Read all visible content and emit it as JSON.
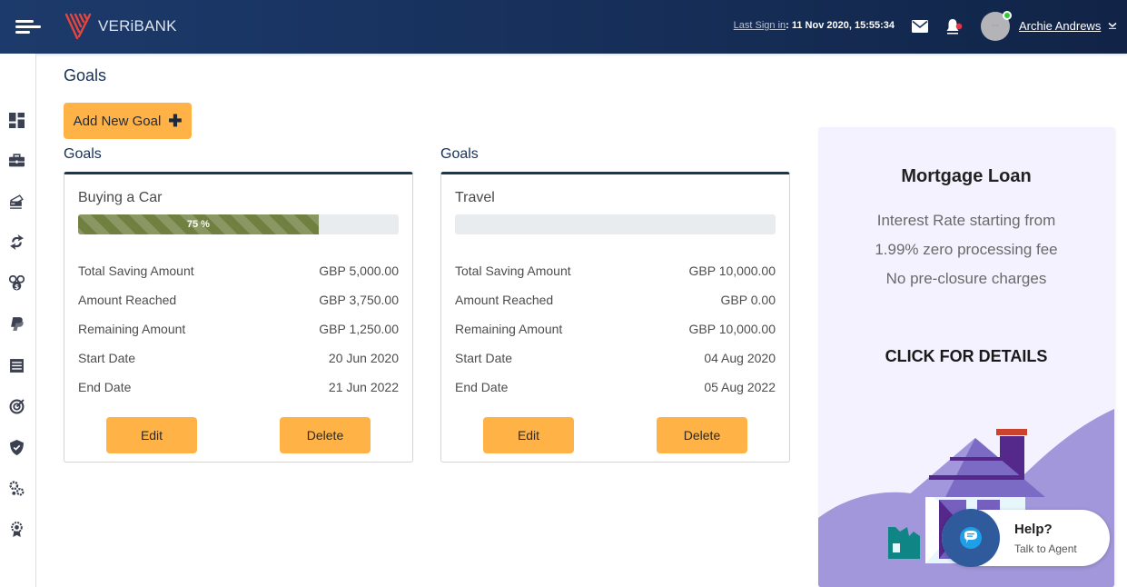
{
  "header": {
    "brand": "VERiBANK",
    "last_signin_label": "Last Sign in",
    "last_signin_value": ": 11 Nov 2020, 15:55:34",
    "user_name": "Archie Andrews",
    "notification_dot_color": "#e8334a",
    "online_status_color": "#2ecc2e"
  },
  "sidebar": {
    "items": [
      {
        "icon": "dashboard-icon"
      },
      {
        "icon": "briefcase-icon"
      },
      {
        "icon": "cards-icon"
      },
      {
        "icon": "transfer-icon"
      },
      {
        "icon": "coins-icon"
      },
      {
        "icon": "paypal-icon"
      },
      {
        "icon": "statement-icon"
      },
      {
        "icon": "target-icon"
      },
      {
        "icon": "shield-icon"
      },
      {
        "icon": "settings-icon"
      },
      {
        "icon": "award-icon"
      }
    ]
  },
  "page": {
    "title": "Goals",
    "add_button": "Add New Goal"
  },
  "goals": [
    {
      "section_title": "Goals",
      "name": "Buying a Car",
      "progress_percent": 75,
      "progress_label": "75 %",
      "rows": [
        {
          "label": "Total Saving Amount",
          "value": "GBP 5,000.00"
        },
        {
          "label": "Amount Reached",
          "value": "GBP 3,750.00"
        },
        {
          "label": "Remaining Amount",
          "value": "GBP 1,250.00"
        },
        {
          "label": "Start Date",
          "value": "20 Jun 2020"
        },
        {
          "label": "End Date",
          "value": "21 Jun 2022"
        }
      ],
      "edit_label": "Edit",
      "delete_label": "Delete"
    },
    {
      "section_title": "Goals",
      "name": "Travel",
      "progress_percent": 0,
      "progress_label": "",
      "rows": [
        {
          "label": "Total Saving Amount",
          "value": "GBP 10,000.00"
        },
        {
          "label": "Amount Reached",
          "value": "GBP 0.00"
        },
        {
          "label": "Remaining Amount",
          "value": "GBP 10,000.00"
        },
        {
          "label": "Start Date",
          "value": "04 Aug 2020"
        },
        {
          "label": "End Date",
          "value": "05 Aug 2022"
        }
      ],
      "edit_label": "Edit",
      "delete_label": "Delete"
    }
  ],
  "promo": {
    "title": "Mortgage Loan",
    "description": "Interest Rate starting from 1.99% zero processing fee No pre-closure charges",
    "cta": "CLICK FOR DETAILS"
  },
  "help": {
    "title": "Help?",
    "subtitle": "Talk to Agent"
  },
  "colors": {
    "header_bg": "#17305b",
    "accent_button": "#ffb347",
    "progress_fill": "#708040",
    "card_top_border": "#17384f"
  }
}
